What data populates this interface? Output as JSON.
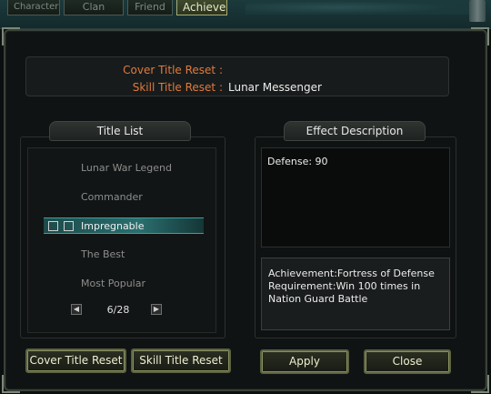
{
  "tabs": [
    {
      "label": "Character"
    },
    {
      "label": "Clan"
    },
    {
      "label": "Friend"
    },
    {
      "label": "Achieve"
    }
  ],
  "reset_info": {
    "cover_label": "Cover Title Reset :",
    "cover_value": "",
    "skill_label": "Skill Title Reset :",
    "skill_value": "Lunar Messenger"
  },
  "title_list": {
    "header": "Title List",
    "items": [
      {
        "label": "Lunar War Legend",
        "selected": false
      },
      {
        "label": "Commander",
        "selected": false
      },
      {
        "label": "Impregnable",
        "selected": true
      },
      {
        "label": "The Best",
        "selected": false
      },
      {
        "label": "Most Popular",
        "selected": false
      }
    ],
    "page": "6/28"
  },
  "effect": {
    "header": "Effect Description",
    "text": "Defense: 90",
    "achievement": "Achievement:Fortress of Defense\n Requirement:Win 100 times in Nation Guard Battle"
  },
  "buttons": {
    "cover_reset": "Cover Title Reset",
    "skill_reset": "Skill Title Reset",
    "apply": "Apply",
    "close": "Close"
  },
  "colors": {
    "label_orange": "#e07a3c",
    "selection_teal": "#2b6e6e"
  }
}
